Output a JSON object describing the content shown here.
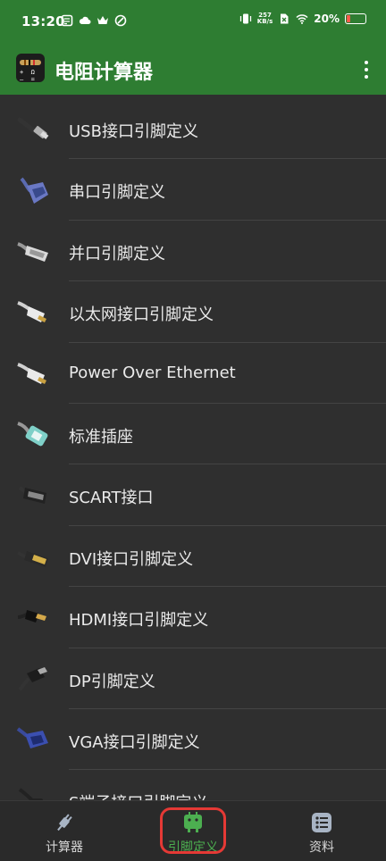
{
  "status_bar": {
    "time": "13:20",
    "net_speed_value": "257",
    "net_speed_unit": "KB/s",
    "battery_percent": "20%",
    "battery_level": 0.2,
    "left_icons": [
      "notes-icon",
      "cloud-icon",
      "crown-icon",
      "leaf-icon"
    ],
    "right_icons": [
      "vibrate-icon",
      "sim-off-icon",
      "wifi-icon",
      "battery-icon"
    ]
  },
  "app_bar": {
    "title": "电阻计算器",
    "app_icon": "resistor-calculator-icon",
    "menu_icon": "more-vert-icon"
  },
  "list": {
    "items": [
      {
        "label": "USB接口引脚定义",
        "icon": "usb-cable-icon"
      },
      {
        "label": "串口引脚定义",
        "icon": "serial-port-icon"
      },
      {
        "label": "并口引脚定义",
        "icon": "parallel-port-icon"
      },
      {
        "label": "以太网接口引脚定义",
        "icon": "ethernet-cable-icon"
      },
      {
        "label": "Power Over Ethernet",
        "icon": "poe-cable-icon"
      },
      {
        "label": "标准插座",
        "icon": "rj-socket-icon"
      },
      {
        "label": "SCART接口",
        "icon": "scart-cable-icon"
      },
      {
        "label": "DVI接口引脚定义",
        "icon": "dvi-cable-icon"
      },
      {
        "label": "HDMI接口引脚定义",
        "icon": "hdmi-cable-icon"
      },
      {
        "label": "DP引脚定义",
        "icon": "displayport-cable-icon"
      },
      {
        "label": "VGA接口引脚定义",
        "icon": "vga-cable-icon"
      },
      {
        "label": "S端子接口引脚定义",
        "icon": "s-video-cable-icon"
      }
    ]
  },
  "bottom_nav": {
    "items": [
      {
        "label": "计算器",
        "icon": "plug-icon",
        "active": false
      },
      {
        "label": "引脚定义",
        "icon": "android-connector-icon",
        "active": true
      },
      {
        "label": "资料",
        "icon": "list-icon",
        "active": false
      }
    ]
  },
  "colors": {
    "accent": "#2e7d32",
    "active_nav": "#4caf50",
    "background": "#2f2f2f",
    "highlight": "#e53935"
  }
}
